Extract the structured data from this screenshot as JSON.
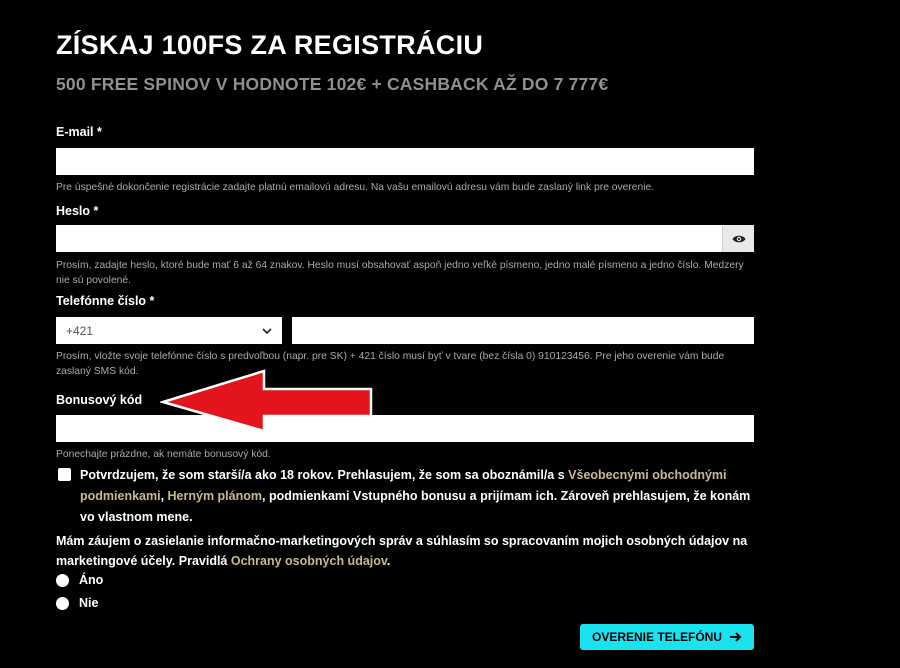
{
  "header": {
    "title": "ZÍSKAJ 100FS ZA REGISTRÁCIU",
    "subtitle": "500 FREE SPINOV V HODNOTE 102€ + CASHBACK AŽ DO 7 777€"
  },
  "email": {
    "label": "E-mail *",
    "value": "",
    "help": "Pre úspešné dokončenie registrácie zadajte platnú emailovú adresu. Na vašu emailovú adresu vám bude zaslaný link pre overenie."
  },
  "password": {
    "label": "Heslo *",
    "value": "",
    "help": "Prosím, zadajte heslo, ktoré bude mať 6 až 64 znakov. Heslo musí obsahovať aspoň jedno veľké písmeno, jedno malé písmeno a jedno číslo. Medzery nie sú povolené."
  },
  "phone": {
    "label": "Telefónne číslo *",
    "prefix": "+421",
    "value": "",
    "help": "Prosím, vložte svoje telefónne číslo s predvoľbou (napr. pre SK) + 421 číslo musí byť v tvare (bez čísla 0) 910123456. Pre jeho overenie vám bude zaslaný SMS kód."
  },
  "bonus": {
    "label": "Bonusový kód",
    "value": "",
    "help": "Ponechajte prázdne, ak nemáte bonusový kód."
  },
  "terms": {
    "text1": "Potvrdzujem, že som starší/a ako 18 rokov. Prehlasujem, že som sa oboznámil/a s ",
    "link1": "Všeobecnými obchodnými podmienkami",
    "text2": ", ",
    "link2": "Herným plánom",
    "text3": ", podmienkami Vstupného bonusu a prijímam ich. Zároveň prehlasujem, že konám vo vlastnom mene."
  },
  "marketing": {
    "text": "Mám záujem o zasielanie informačno-marketingových správ a súhlasím so spracovaním mojich osobných údajov na marketingové účely. Pravidlá ",
    "link": "Ochrany osobných údajov",
    "end": ".",
    "options": [
      "Áno",
      "Nie"
    ]
  },
  "cta": {
    "label": "OVERENIE TELEFÓNU"
  },
  "colors": {
    "accent": "#19e3ef",
    "link": "#c9b98a",
    "arrow": "#e3141b"
  }
}
